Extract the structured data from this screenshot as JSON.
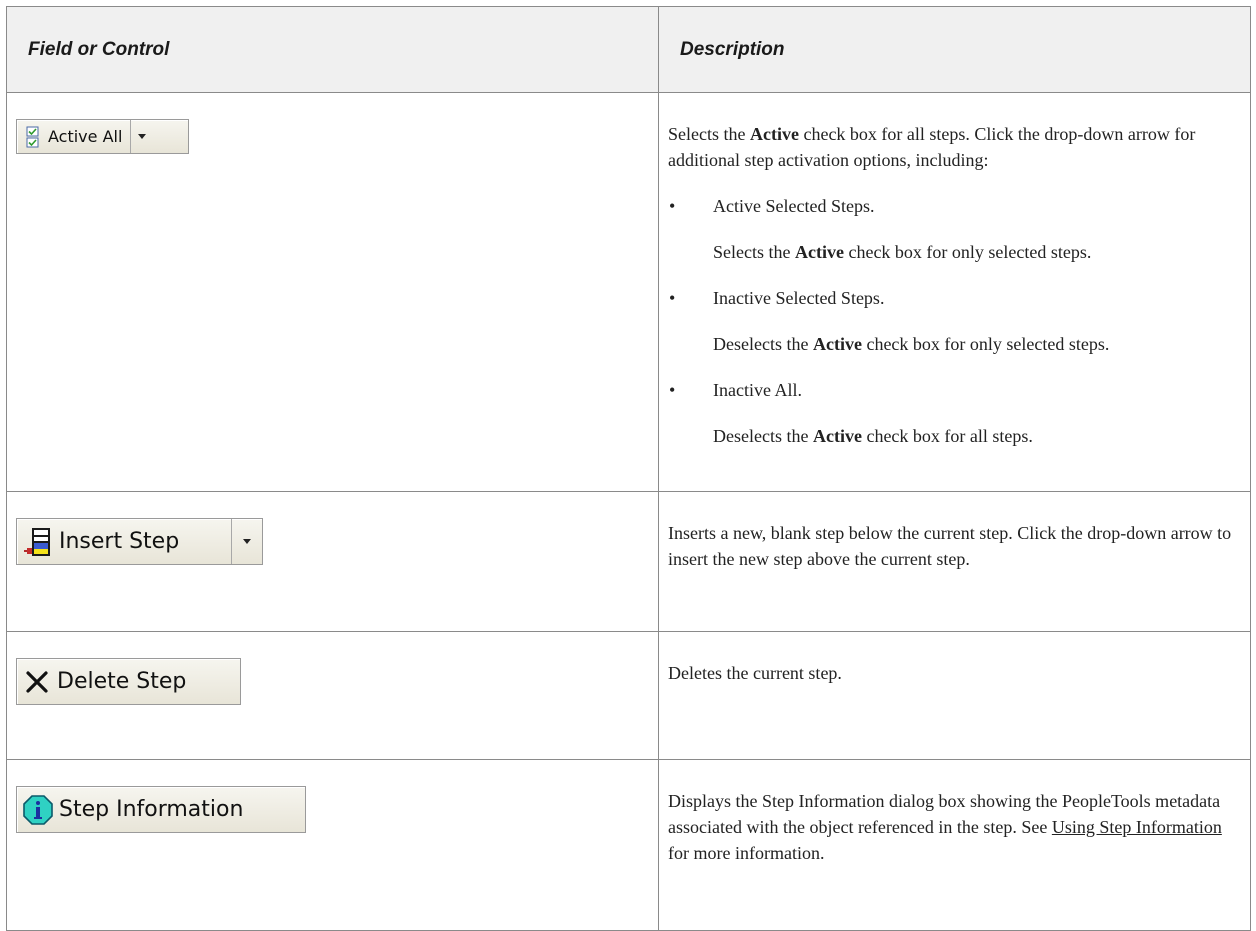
{
  "table": {
    "header_left": "Field or Control",
    "header_right": "Description"
  },
  "rows": [
    {
      "button_label": "Active All",
      "icon": "checklist-icon",
      "intro_pre": "Selects the ",
      "intro_bold": "Active",
      "intro_post": " check box for all steps. Click the drop-down arrow for additional step activation options, including:",
      "bullets": [
        {
          "title": "Active Selected Steps.",
          "desc_pre": "Selects the ",
          "desc_bold": "Active",
          "desc_post": " check box for only selected steps."
        },
        {
          "title": "Inactive Selected Steps.",
          "desc_pre": "Deselects the ",
          "desc_bold": "Active",
          "desc_post": " check box for only selected steps."
        },
        {
          "title": "Inactive All.",
          "desc_pre": "Deselects the ",
          "desc_bold": "Active",
          "desc_post": " check box for all steps."
        }
      ]
    },
    {
      "button_label": "Insert Step",
      "icon": "insert-step-icon",
      "description": "Inserts a new, blank step below the current step. Click the drop-down arrow to insert the new step above the current step."
    },
    {
      "button_label": "Delete Step",
      "icon": "delete-x-icon",
      "description": "Deletes the current step."
    },
    {
      "button_label": "Step Information",
      "icon": "info-icon",
      "desc_pre": "Displays the Step Information dialog box showing the PeopleTools metadata associated with the object referenced in the step. See ",
      "desc_link": "Using Step Information",
      "desc_post": " for more information."
    }
  ],
  "colors": {
    "header_bg": "#f0f0f0",
    "border": "#8a8a8a",
    "button_bg": "#ece9d8",
    "info_icon": "#2fd1c3"
  }
}
